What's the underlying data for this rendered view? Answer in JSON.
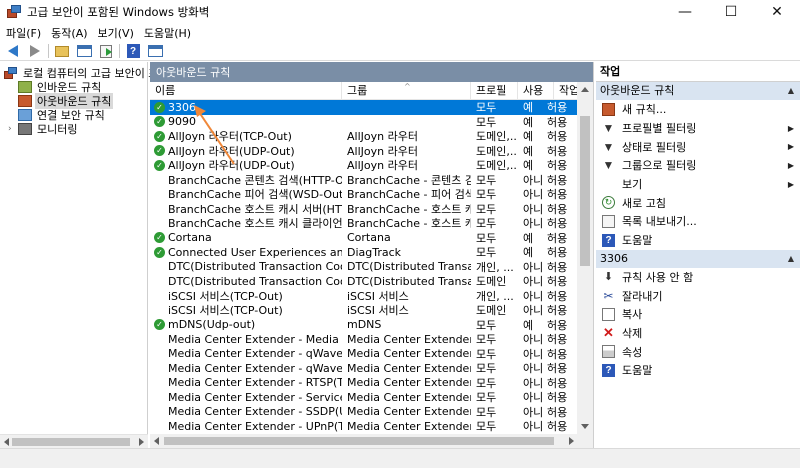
{
  "window": {
    "title": "고급 보안이 포함된 Windows 방화벽",
    "minimize": "—",
    "maximize": "☐",
    "close": "✕"
  },
  "menu": [
    "파일(F)",
    "동작(A)",
    "보기(V)",
    "도움말(H)"
  ],
  "tree": {
    "root": "로컬 컴퓨터의 고급 보안이 포함",
    "items": [
      "인바운드 규칙",
      "아웃바운드 규칙",
      "연결 보안 규칙",
      "모니터링"
    ],
    "selected": "아웃바운드 규칙"
  },
  "center": {
    "header": "아웃바운드 규칙",
    "columns": [
      "이름",
      "그룹",
      "프로필",
      "사용",
      "작업"
    ],
    "rows": [
      {
        "name": "3306",
        "group": "",
        "profile": "모두",
        "enabled": "예",
        "action": "허용",
        "checked": true,
        "selected": true
      },
      {
        "name": "9090",
        "group": "",
        "profile": "모두",
        "enabled": "예",
        "action": "허용",
        "checked": true
      },
      {
        "name": "AllJoyn 라우터(TCP-Out)",
        "group": "AllJoyn 라우터",
        "profile": "도메인,...",
        "enabled": "예",
        "action": "허용",
        "checked": true
      },
      {
        "name": "AllJoyn 라우터(UDP-Out)",
        "group": "AllJoyn 라우터",
        "profile": "도메인,...",
        "enabled": "예",
        "action": "허용",
        "checked": true
      },
      {
        "name": "AllJoyn 라우터(UDP-Out)",
        "group": "AllJoyn 라우터",
        "profile": "도메인,...",
        "enabled": "예",
        "action": "허용",
        "checked": true
      },
      {
        "name": "BranchCache 콘텐츠 검색(HTTP-Out)",
        "group": "BranchCache - 콘텐츠 검색...",
        "profile": "모두",
        "enabled": "아니요",
        "action": "허용",
        "checked": false
      },
      {
        "name": "BranchCache 피어 검색(WSD-Out)",
        "group": "BranchCache - 피어 검색(…",
        "profile": "모두",
        "enabled": "아니요",
        "action": "허용",
        "checked": false
      },
      {
        "name": "BranchCache 호스트 캐시 서버(HTTP-O...",
        "group": "BranchCache - 호스트 캐시...",
        "profile": "모두",
        "enabled": "아니요",
        "action": "허용",
        "checked": false
      },
      {
        "name": "BranchCache 호스트 캐시 클라이언트(H...",
        "group": "BranchCache - 호스트 캐시...",
        "profile": "모두",
        "enabled": "아니요",
        "action": "허용",
        "checked": false
      },
      {
        "name": "Cortana",
        "group": "Cortana",
        "profile": "모두",
        "enabled": "예",
        "action": "허용",
        "checked": true
      },
      {
        "name": "Connected User Experiences and Teleme...",
        "group": "DiagTrack",
        "profile": "모두",
        "enabled": "예",
        "action": "허용",
        "checked": true
      },
      {
        "name": "DTC(Distributed Transaction Coordinato...",
        "group": "DTC(Distributed Transaction...",
        "profile": "개인, ...",
        "enabled": "아니요",
        "action": "허용",
        "checked": false
      },
      {
        "name": "DTC(Distributed Transaction Coordinato...",
        "group": "DTC(Distributed Transaction...",
        "profile": "도메인",
        "enabled": "아니요",
        "action": "허용",
        "checked": false
      },
      {
        "name": "iSCSI 서비스(TCP-Out)",
        "group": "iSCSI 서비스",
        "profile": "개인, ...",
        "enabled": "아니요",
        "action": "허용",
        "checked": false
      },
      {
        "name": "iSCSI 서비스(TCP-Out)",
        "group": "iSCSI 서비스",
        "profile": "도메인",
        "enabled": "아니요",
        "action": "허용",
        "checked": false
      },
      {
        "name": "mDNS(Udp-out)",
        "group": "mDNS",
        "profile": "모두",
        "enabled": "예",
        "action": "허용",
        "checked": true
      },
      {
        "name": "Media Center Extender - Media 스트리...",
        "group": "Media Center Extender",
        "profile": "모두",
        "enabled": "아니요",
        "action": "허용",
        "checked": false
      },
      {
        "name": "Media Center Extender - qWave(TCP-Out)",
        "group": "Media Center Extender",
        "profile": "모두",
        "enabled": "아니요",
        "action": "허용",
        "checked": false
      },
      {
        "name": "Media Center Extender - qWave(UDP-O...",
        "group": "Media Center Extender",
        "profile": "모두",
        "enabled": "아니요",
        "action": "허용",
        "checked": false
      },
      {
        "name": "Media Center Extender - RTSP(TCP-Out)",
        "group": "Media Center Extender",
        "profile": "모두",
        "enabled": "아니요",
        "action": "허용",
        "checked": false
      },
      {
        "name": "Media Center Extender - Service(TCP-O...",
        "group": "Media Center Extender",
        "profile": "모두",
        "enabled": "아니요",
        "action": "허용",
        "checked": false
      },
      {
        "name": "Media Center Extender - SSDP(UDP-Out)",
        "group": "Media Center Extender",
        "profile": "모두",
        "enabled": "아니요",
        "action": "허용",
        "checked": false
      },
      {
        "name": "Media Center Extender - UPnP(TCP-Out)",
        "group": "Media Center Extender",
        "profile": "모두",
        "enabled": "아니요",
        "action": "허용",
        "checked": false
      }
    ]
  },
  "actions": {
    "title": "작업",
    "section1": "아웃바운드 규칙",
    "section1_items": [
      {
        "label": "새 규칙...",
        "icon": "new-rule-icon",
        "sub": false
      },
      {
        "label": "프로필별 필터링",
        "icon": "filter-icon",
        "sub": true
      },
      {
        "label": "상태로 필터링",
        "icon": "filter-icon",
        "sub": true
      },
      {
        "label": "그룹으로 필터링",
        "icon": "filter-icon",
        "sub": true
      },
      {
        "label": "보기",
        "icon": "view-icon",
        "sub": true
      },
      {
        "label": "새로 고침",
        "icon": "refresh-icon",
        "sub": false
      },
      {
        "label": "목록 내보내기...",
        "icon": "export-icon",
        "sub": false
      },
      {
        "label": "도움말",
        "icon": "help-icon",
        "sub": false
      }
    ],
    "section2": "3306",
    "section2_items": [
      {
        "label": "규칙 사용 안 함",
        "icon": "disable-rule-icon"
      },
      {
        "label": "잘라내기",
        "icon": "cut-icon"
      },
      {
        "label": "복사",
        "icon": "copy-icon"
      },
      {
        "label": "삭제",
        "icon": "delete-icon"
      },
      {
        "label": "속성",
        "icon": "properties-icon"
      },
      {
        "label": "도움말",
        "icon": "help-icon"
      }
    ]
  },
  "colors": {
    "selection": "#0078d7",
    "pane_header": "#7a8ea6",
    "section_bg": "#d9e4f1",
    "annotation_arrow": "#f0883a",
    "enabled_check": "#2e9b35"
  }
}
